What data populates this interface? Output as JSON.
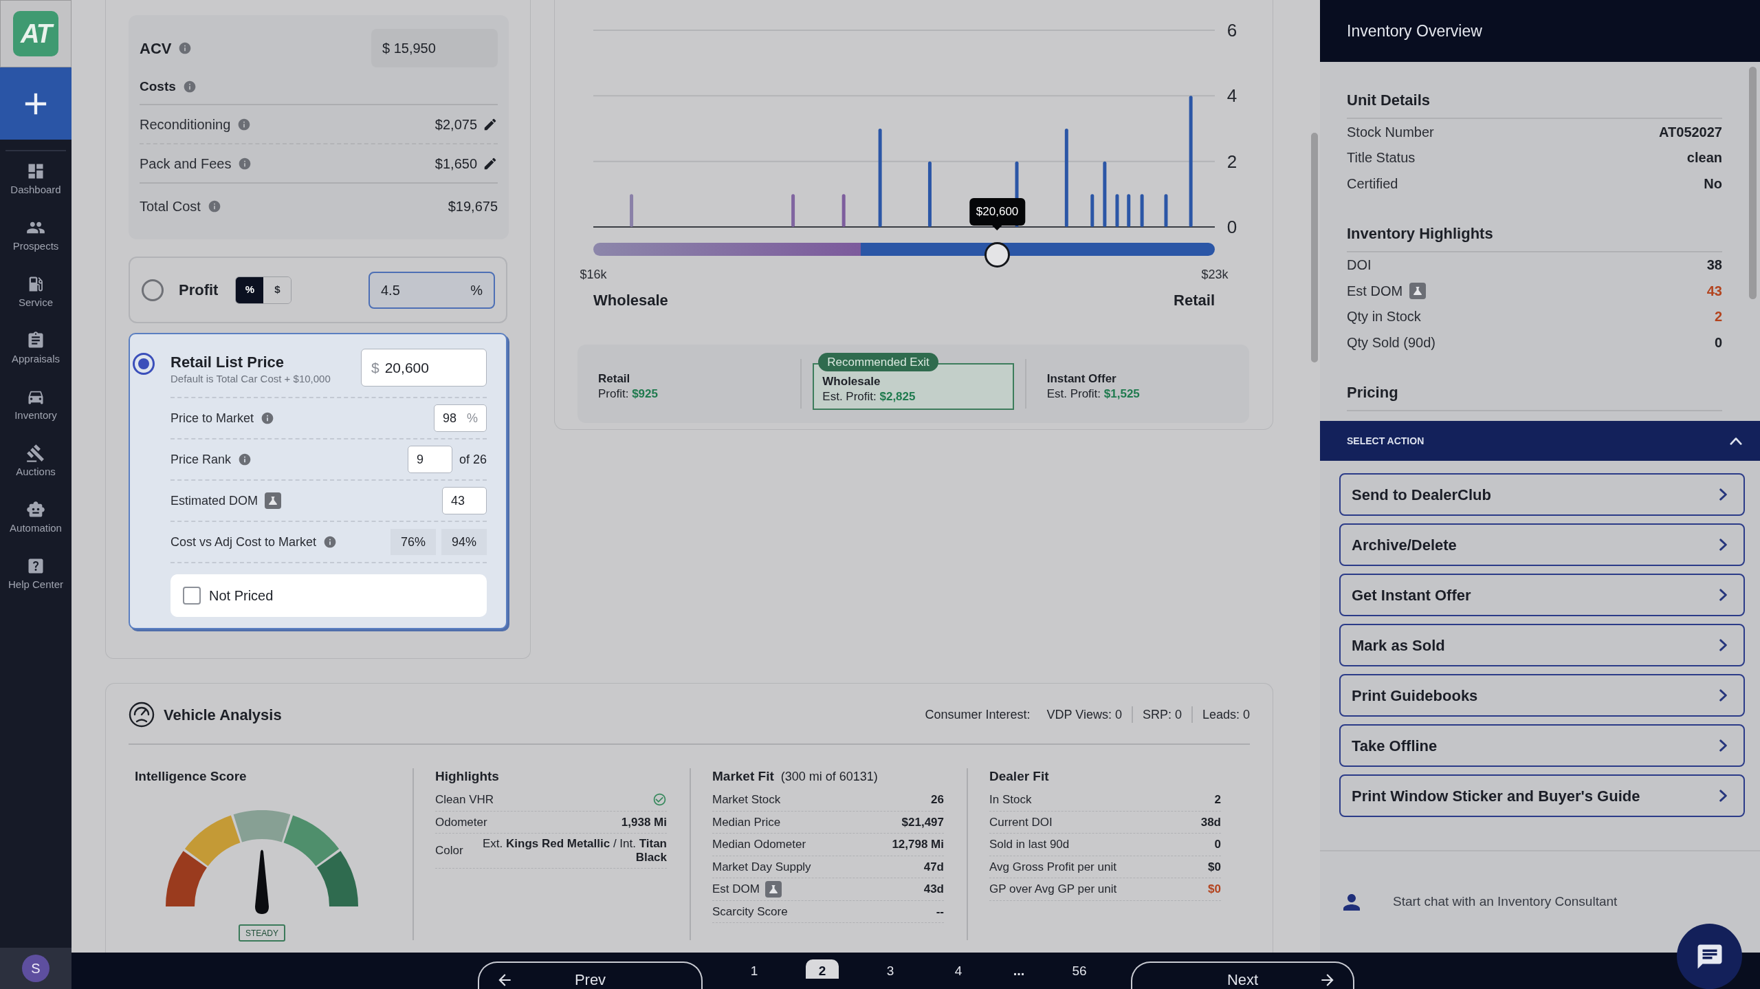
{
  "sidebar": {
    "logo": "AT",
    "items": [
      {
        "label": "Dashboard",
        "selected": false
      },
      {
        "label": "Prospects",
        "selected": false
      },
      {
        "label": "Service",
        "selected": false
      },
      {
        "label": "Appraisals",
        "selected": false
      },
      {
        "label": "Inventory",
        "selected": false
      },
      {
        "label": "Auctions",
        "selected": false
      },
      {
        "label": "Automation",
        "selected": false
      },
      {
        "label": "Help Center",
        "selected": false
      }
    ],
    "user_initial": "S"
  },
  "pricing": {
    "acv": {
      "label": "ACV",
      "help": true,
      "value": "$ 15,950"
    },
    "costs": {
      "label": "Costs",
      "help": true,
      "rows": [
        {
          "label": "Reconditioning",
          "help": true,
          "value": "$2,075",
          "editable": true
        },
        {
          "label": "Pack and Fees",
          "help": true,
          "value": "$1,650",
          "editable": true
        },
        {
          "label": "Total Cost",
          "help": true,
          "value": "$19,675",
          "editable": false
        }
      ]
    },
    "options": [
      {
        "kind": "profit",
        "label": "Profit",
        "selected": false,
        "units": [
          {
            "label": "%",
            "selected": true
          },
          {
            "label": "$",
            "selected": false
          }
        ],
        "value": "4.5",
        "suffix": "%"
      },
      {
        "kind": "retail",
        "label": "Retail List Price",
        "selected": true,
        "note": "Default is Total Car Cost + $10,000",
        "prefix": "$",
        "value": "20,600",
        "rows": [
          {
            "kind": "input",
            "label": "Price to Market",
            "help": true,
            "beta": false,
            "value": "98",
            "suffix": "%"
          },
          {
            "kind": "input",
            "label": "Price Rank",
            "help": true,
            "beta": false,
            "value": "9",
            "after": "of 26"
          },
          {
            "kind": "input",
            "label": "Estimated DOM",
            "help": false,
            "beta": true,
            "value": "43"
          },
          {
            "kind": "pair",
            "label": "Cost vs Adj Cost to Market",
            "help": true,
            "beta": false,
            "values": [
              "76%",
              "94%"
            ]
          }
        ],
        "not_priced": {
          "label": "Not Priced",
          "checked": false
        }
      }
    ]
  },
  "market": {
    "chart_data": {
      "type": "bar",
      "x": [
        16430,
        18250,
        18820,
        19230,
        19790,
        20770,
        21330,
        21620,
        21760,
        21900,
        22030,
        22180,
        22450,
        22730
      ],
      "values": [
        1,
        1,
        1,
        3,
        2,
        2,
        3,
        1,
        2,
        1,
        1,
        1,
        1,
        4
      ],
      "xlim": [
        16000,
        23000
      ],
      "ylim": [
        0,
        6
      ],
      "xticks": [
        {
          "value": 16000,
          "label": "$16k"
        },
        {
          "value": 23000,
          "label": "$23k"
        }
      ],
      "yticks": [
        0,
        2,
        4,
        6
      ]
    },
    "slider": {
      "level": 0.65,
      "value_label": "$20,600",
      "left_title": "Wholesale",
      "right_title": "Retail"
    },
    "exits": [
      {
        "title": "Retail",
        "profit": "Profit: **$925**",
        "recommended": false
      },
      {
        "title": "Wholesale",
        "profit": "Est. Profit: **$2,825**",
        "recommended": true,
        "badge": "Recommended Exit"
      },
      {
        "title": "Instant Offer",
        "profit": "Est. Profit: **$1,525**",
        "recommended": false
      }
    ]
  },
  "inventory_overview": {
    "title": "Inventory Overview",
    "sections": [
      {
        "title": "Unit Details",
        "rows": [
          {
            "label": "Stock Number",
            "value": "AT052027",
            "beta": false,
            "alert": false
          },
          {
            "label": "Title Status",
            "value": "clean",
            "beta": false,
            "alert": false
          },
          {
            "label": "Certified",
            "value": "No",
            "beta": false,
            "alert": false
          }
        ]
      },
      {
        "title": "Inventory Highlights",
        "rows": [
          {
            "label": "DOI",
            "value": "38",
            "beta": false,
            "alert": false
          },
          {
            "label": "Est DOM",
            "value": "43",
            "beta": true,
            "alert": true
          },
          {
            "label": "Qty in Stock",
            "value": "2",
            "beta": false,
            "alert": true
          },
          {
            "label": "Qty Sold (90d)",
            "value": "0",
            "beta": false,
            "alert": false
          }
        ]
      },
      {
        "title": "Pricing"
      }
    ]
  },
  "select_action": {
    "title": "SELECT ACTION",
    "expanded": true,
    "actions": [
      "Send to DealerClub",
      "Archive/Delete",
      "Get Instant Offer",
      "Mark as Sold",
      "Print Guidebooks",
      "Take Offline",
      "Print Window Sticker and Buyer's Guide"
    ]
  },
  "chat_prompt": "Start chat with an Inventory Consultant",
  "vehicle_analysis": {
    "title": "Vehicle Analysis",
    "interest_label": "Consumer Interest:",
    "interest_stats": [
      "VDP Views: 0",
      "SRP: 0",
      "Leads: 0"
    ],
    "score": {
      "title": "Intelligence Score",
      "level": 0.5,
      "rating": "STEADY"
    },
    "columns": [
      {
        "title": "Highlights",
        "rows": [
          {
            "kind": "check",
            "label": "Clean VHR",
            "checked": true
          },
          {
            "kind": "value",
            "label": "Odometer",
            "value": "1,938 Mi",
            "beta": false,
            "alert": false
          },
          {
            "kind": "detail",
            "label": "Color",
            "value": "Ext. **Kings Red Metallic** / Int. **Titan Black**"
          }
        ]
      },
      {
        "title": "Market Fit",
        "subtitle": "(300 mi of 60131)",
        "rows": [
          {
            "kind": "value",
            "label": "Market Stock",
            "value": "26",
            "beta": false,
            "alert": false
          },
          {
            "kind": "value",
            "label": "Median Price",
            "value": "$21,497",
            "beta": false,
            "alert": false
          },
          {
            "kind": "value",
            "label": "Median Odometer",
            "value": "12,798 Mi",
            "beta": false,
            "alert": false
          },
          {
            "kind": "value",
            "label": "Market Day Supply",
            "value": "47d",
            "beta": false,
            "alert": false
          },
          {
            "kind": "value",
            "label": "Est DOM",
            "value": "43d",
            "beta": true,
            "alert": false
          },
          {
            "kind": "value",
            "label": "Scarcity Score",
            "value": "--",
            "beta": false,
            "alert": false
          }
        ]
      },
      {
        "title": "Dealer Fit",
        "rows": [
          {
            "kind": "value",
            "label": "In Stock",
            "value": "2",
            "beta": false,
            "alert": false
          },
          {
            "kind": "value",
            "label": "Current DOI",
            "value": "38d",
            "beta": false,
            "alert": false
          },
          {
            "kind": "value",
            "label": "Sold in last 90d",
            "value": "0",
            "beta": false,
            "alert": false
          },
          {
            "kind": "value",
            "label": "Avg Gross Profit per unit",
            "value": "$0",
            "beta": false,
            "alert": false
          },
          {
            "kind": "value",
            "label": "GP over Avg GP per unit",
            "value": "$0",
            "beta": false,
            "alert": true
          }
        ]
      }
    ]
  },
  "pagination": {
    "prev": "Prev",
    "next": "Next",
    "pages": [
      {
        "kind": "page",
        "label": "1",
        "selected": false
      },
      {
        "kind": "page",
        "label": "2",
        "selected": true
      },
      {
        "kind": "page",
        "label": "3",
        "selected": false
      },
      {
        "kind": "page",
        "label": "4",
        "selected": false
      },
      {
        "kind": "gap",
        "label": "...",
        "selected": false
      },
      {
        "kind": "page",
        "label": "56",
        "selected": false
      }
    ]
  }
}
